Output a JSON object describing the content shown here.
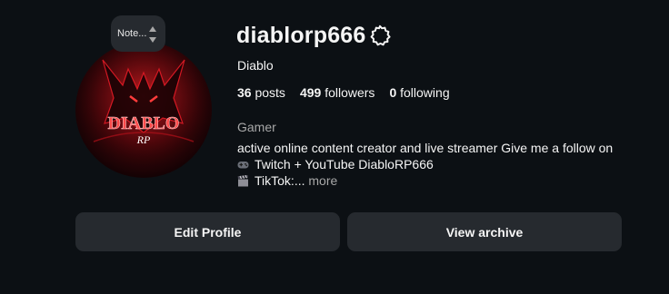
{
  "profile": {
    "username": "diablorp666",
    "full_name": "Diablo",
    "note": "Note...",
    "avatar_text_1": "DIABLO",
    "avatar_text_2": "RP",
    "stats": {
      "posts_count": "36",
      "posts_label": "posts",
      "followers_count": "499",
      "followers_label": "followers",
      "following_count": "0",
      "following_label": "following"
    },
    "category": "Gamer",
    "bio": {
      "line1": "active online content creator and live streamer Give me a follow on",
      "line2": "Twitch + YouTube DiabloRP666",
      "line3": "TikTok:...",
      "more": "more"
    }
  },
  "buttons": {
    "edit_profile": "Edit Profile",
    "view_archive": "View archive"
  },
  "icons": {
    "settings": "gear-icon",
    "note_arrows": "up-down-arrows-icon",
    "bio_line2": "game-controller-emoji-icon",
    "bio_line3": "clapper-board-emoji-icon"
  },
  "colors": {
    "background": "#0c1014",
    "button": "#262a2f",
    "text": "#f5f5f5",
    "muted": "#a8a8a8",
    "avatar_red": "#c8101c"
  }
}
